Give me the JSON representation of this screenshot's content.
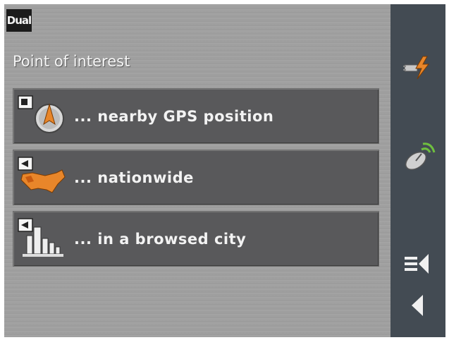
{
  "header": {
    "logo_text": "Dual",
    "title": "Point of interest"
  },
  "menu": {
    "items": [
      {
        "label": "... nearby GPS position",
        "icon": "gps-compass-icon"
      },
      {
        "label": "... nationwide",
        "icon": "usa-map-icon"
      },
      {
        "label": "... in a browsed city",
        "icon": "city-skyline-icon"
      }
    ]
  },
  "sidebar": {
    "buttons": [
      "power-plug-icon",
      "satellite-icon",
      "menu-back-icon",
      "back-arrow-icon"
    ]
  },
  "colors": {
    "panel": "#59595b",
    "sidebar": "#434b53",
    "accent": "#e8862a",
    "text": "#f3f3f3"
  }
}
